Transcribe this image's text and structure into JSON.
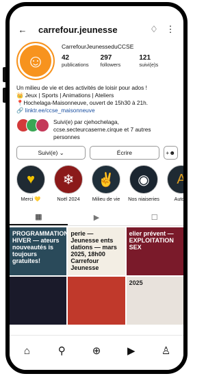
{
  "header": {
    "title": "carrefour.jeunesse",
    "back_icon": "←",
    "bell_icon": "♢",
    "more_icon": "⋮"
  },
  "profile": {
    "display_name": "CarrefourJeunesseduCCSE",
    "avatar_icon": "☺",
    "stats": [
      {
        "value": "42",
        "label": "publications"
      },
      {
        "value": "297",
        "label": "followers"
      },
      {
        "value": "121",
        "label": "suivi(e)s"
      }
    ]
  },
  "bio": {
    "line1": "Un milieu de vie et des activités de loisir pour ados !",
    "line2": "👑 Jeux | Sports | Animations | Ateliers",
    "line3": "📍Hochelaga-Maisonneuve, ouvert de 15h30 à 21h.",
    "link": "🔗 linktr.ee/ccse_maisonneuve"
  },
  "followed_by": {
    "text": "Suivi(e) par cjehochelaga, ccse.secteurcaserne.cirque et 7 autres personnes"
  },
  "buttons": {
    "follow": "Suivi(e) ⌄",
    "message": "Écrire",
    "add_person": "+☻"
  },
  "stories": [
    {
      "label": "Merci 💛",
      "icon": "♥",
      "color": "#f2c200"
    },
    {
      "label": "Noël 2024",
      "icon": "❄",
      "color": "#8b1a1a"
    },
    {
      "label": "Milieu de vie",
      "icon": "✌",
      "color": "#1f2f3a"
    },
    {
      "label": "Nos niaiseries",
      "icon": "◉",
      "color": "#1a2530"
    },
    {
      "label": "Autom",
      "icon": "A",
      "color": "#e0a020"
    }
  ],
  "tabs": {
    "grid_icon": "▦",
    "reels_icon": "▶",
    "tagged_icon": "☐"
  },
  "grid": [
    {
      "text": "PROGRAMMATION HIVER — ateurs nouveautés is toujours gratuites!"
    },
    {
      "text": "perie — Jeunesse ents dations — mars 2025, 18h00 Carrefour Jeunesse"
    },
    {
      "text": "elier prévent — EXPLOITATION SEX"
    },
    {
      "text": ""
    },
    {
      "text": ""
    },
    {
      "text": "2025"
    }
  ],
  "nav": {
    "home": "⌂",
    "search": "⚲",
    "create": "⊕",
    "reels": "▶",
    "profile": "♙"
  }
}
